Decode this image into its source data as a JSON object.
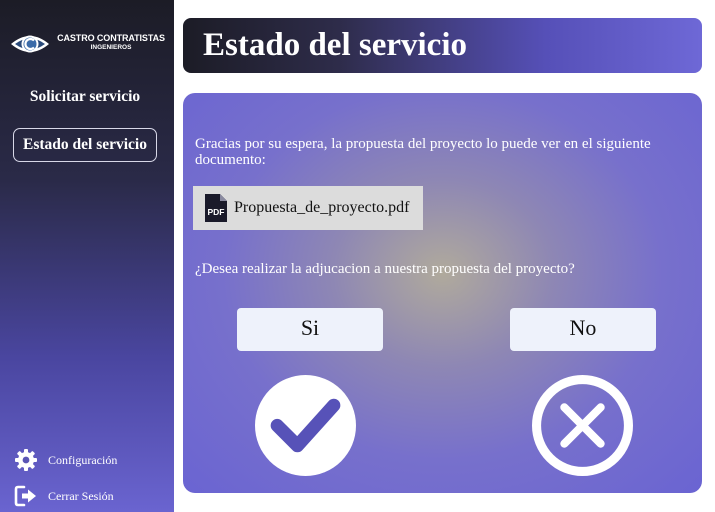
{
  "sidebar": {
    "logo": {
      "line1": "CASTRO CONTRATISTAS",
      "line2": "INGENIEROS",
      "icon": "eye-c-logo"
    },
    "nav": [
      {
        "label": "Solicitar servicio",
        "active": false
      },
      {
        "label": "Estado del servicio",
        "active": true
      }
    ],
    "bottom": [
      {
        "label": "Configuración",
        "icon": "gear-icon"
      },
      {
        "label": "Cerrar Sesión",
        "icon": "logout-icon"
      }
    ]
  },
  "header": {
    "title": "Estado del servicio"
  },
  "main": {
    "message": "Gracias por su espera, la propuesta del proyecto lo puede ver en el siguiente documento:",
    "file": {
      "name": "Propuesta_de_proyecto.pdf",
      "icon": "pdf-file-icon"
    },
    "question": "¿Desea realizar la adjucacion a nuestra propuesta del proyecto?",
    "yes_label": "Si",
    "no_label": "No",
    "icons": {
      "yes": "check-icon",
      "no": "close-icon"
    }
  },
  "colors": {
    "sidebar_dark": "#1c1c26",
    "accent_purple": "#6a64d2",
    "button_bg": "#eef2fb"
  }
}
